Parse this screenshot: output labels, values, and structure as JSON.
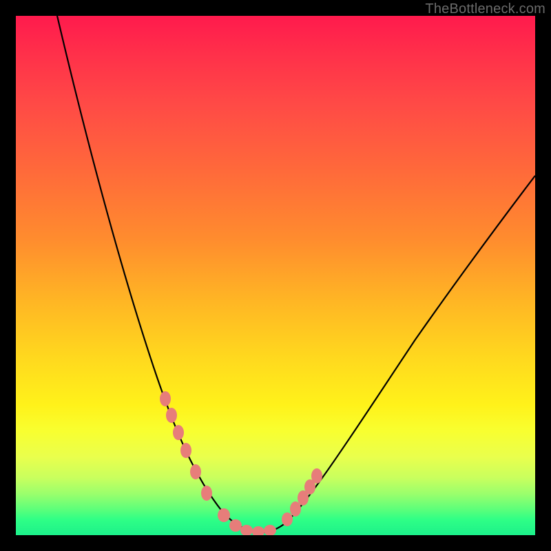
{
  "watermark": "TheBottleneck.com",
  "colors": {
    "frame": "#000000",
    "curve_stroke": "#000000",
    "marker_fill": "#e77d7a",
    "gradient_stops": [
      "#ff1a4d",
      "#ff6a3a",
      "#ffd91e",
      "#f8ff30",
      "#1cf08a"
    ]
  },
  "chart_data": {
    "type": "line",
    "title": "",
    "xlabel": "",
    "ylabel": "",
    "xlim": [
      0,
      100
    ],
    "ylim": [
      0,
      100
    ],
    "grid": false,
    "series": [
      {
        "name": "bottleneck-curve",
        "x": [
          8,
          12,
          16,
          20,
          24,
          28,
          30,
          32,
          34,
          36,
          38,
          40,
          42,
          44,
          46,
          48,
          50,
          54,
          58,
          62,
          66,
          72,
          80,
          90,
          100
        ],
        "values": [
          100,
          90,
          79,
          67,
          55,
          43,
          36,
          30,
          24,
          18,
          13,
          8,
          4,
          2,
          1,
          1,
          2,
          6,
          12,
          18,
          25,
          34,
          45,
          58,
          70
        ]
      }
    ],
    "markers": {
      "name": "highlighted-points",
      "x": [
        29,
        30.5,
        32,
        33,
        35,
        37,
        40,
        42,
        44,
        46,
        48,
        49.5,
        51,
        52.5,
        53.5,
        55
      ],
      "values": [
        38,
        34,
        30,
        27,
        21,
        16,
        8,
        4,
        2,
        1.5,
        1.5,
        2.5,
        3.5,
        5.5,
        7,
        9
      ]
    }
  }
}
